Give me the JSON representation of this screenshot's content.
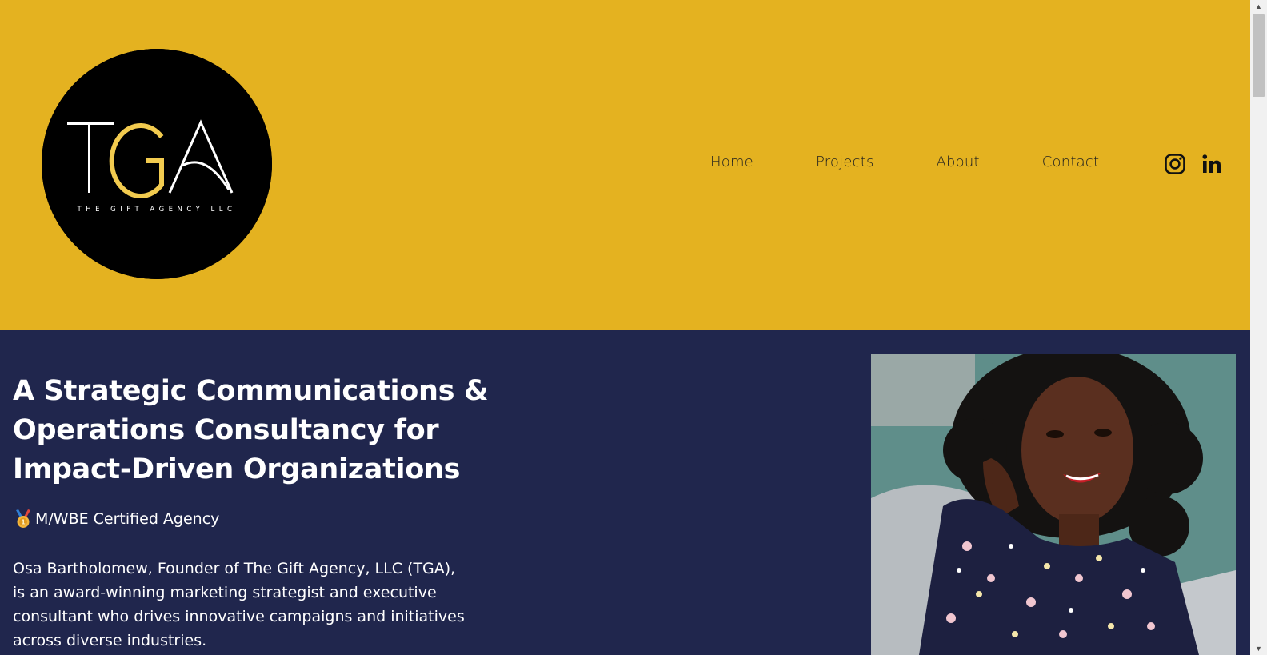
{
  "brand": {
    "logo_letters": "TGA",
    "logo_tagline": "THE GIFT AGENCY LLC",
    "colors": {
      "header_bg": "#e4b220",
      "hero_bg": "#20264d",
      "logo_accent": "#f2cb4f"
    }
  },
  "nav": {
    "items": [
      {
        "label": "Home",
        "active": true
      },
      {
        "label": "Projects",
        "active": false
      },
      {
        "label": "About",
        "active": false
      },
      {
        "label": "Contact",
        "active": false
      }
    ],
    "social": [
      {
        "icon": "instagram-icon"
      },
      {
        "icon": "linkedin-icon"
      }
    ]
  },
  "hero": {
    "title": "A Strategic Communications & Operations Consultancy for Impact-Driven Organizations",
    "badge_icon": "medal-icon",
    "badge_text": "M/WBE Certified Agency",
    "bio": "Osa Bartholomew, Founder of The Gift Agency, LLC (TGA), is an award-winning marketing strategist and executive consultant who drives innovative campaigns and initiatives across diverse industries."
  }
}
